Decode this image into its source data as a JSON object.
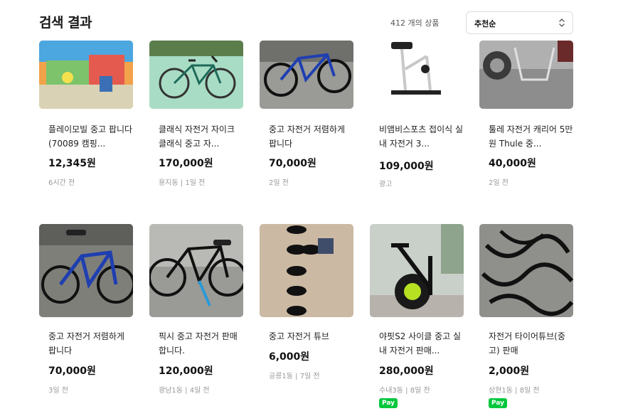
{
  "header": {
    "title": "검색 결과",
    "result_count": "412 개의 상품",
    "sort_selected": "추천순"
  },
  "icons": {
    "sort": "chevron-up-down-icon"
  },
  "colors": {
    "pay_badge": "#00c73c",
    "price_text": "#111111",
    "meta_text": "#999999"
  },
  "products": [
    {
      "title": "플레이모빌 중고 팝니다(70089 캠핑...",
      "price": "12,345원",
      "meta": "6시간 전",
      "pay": ""
    },
    {
      "title": "클래식 자전거 자이크 클래식 중고 자...",
      "price": "170,000원",
      "meta": "용지동 | 1일 전",
      "pay": ""
    },
    {
      "title": "중고 자전거 저렴하게 팝니다",
      "price": "70,000원",
      "meta": "2일 전",
      "pay": ""
    },
    {
      "title": "비앰비스포츠 접이식 실내 자전거 3...",
      "price": "109,000원",
      "meta": "광고",
      "pay": ""
    },
    {
      "title": "툴레 자전거 캐리어 5만원 Thule 중...",
      "price": "40,000원",
      "meta": "2일 전",
      "pay": ""
    },
    {
      "title": "중고 자전거 저렴하게 팝니다",
      "price": "70,000원",
      "meta": "3일 전",
      "pay": ""
    },
    {
      "title": "픽시 중고 자전거 판매합니다.",
      "price": "120,000원",
      "meta": "광남1동 | 4일 전",
      "pay": ""
    },
    {
      "title": "중고 자전거 튜브",
      "price": "6,000원",
      "meta": "공릉1동 | 7일 전",
      "pay": ""
    },
    {
      "title": "야핏S2 사이클 중고 실내 자전거 판매...",
      "price": "280,000원",
      "meta": "수내3동 | 8일 전",
      "pay": "Pay"
    },
    {
      "title": "자전거 타이어튜브(중고) 판매",
      "price": "2,000원",
      "meta": "상현1동 | 8일 전",
      "pay": "Pay"
    }
  ]
}
